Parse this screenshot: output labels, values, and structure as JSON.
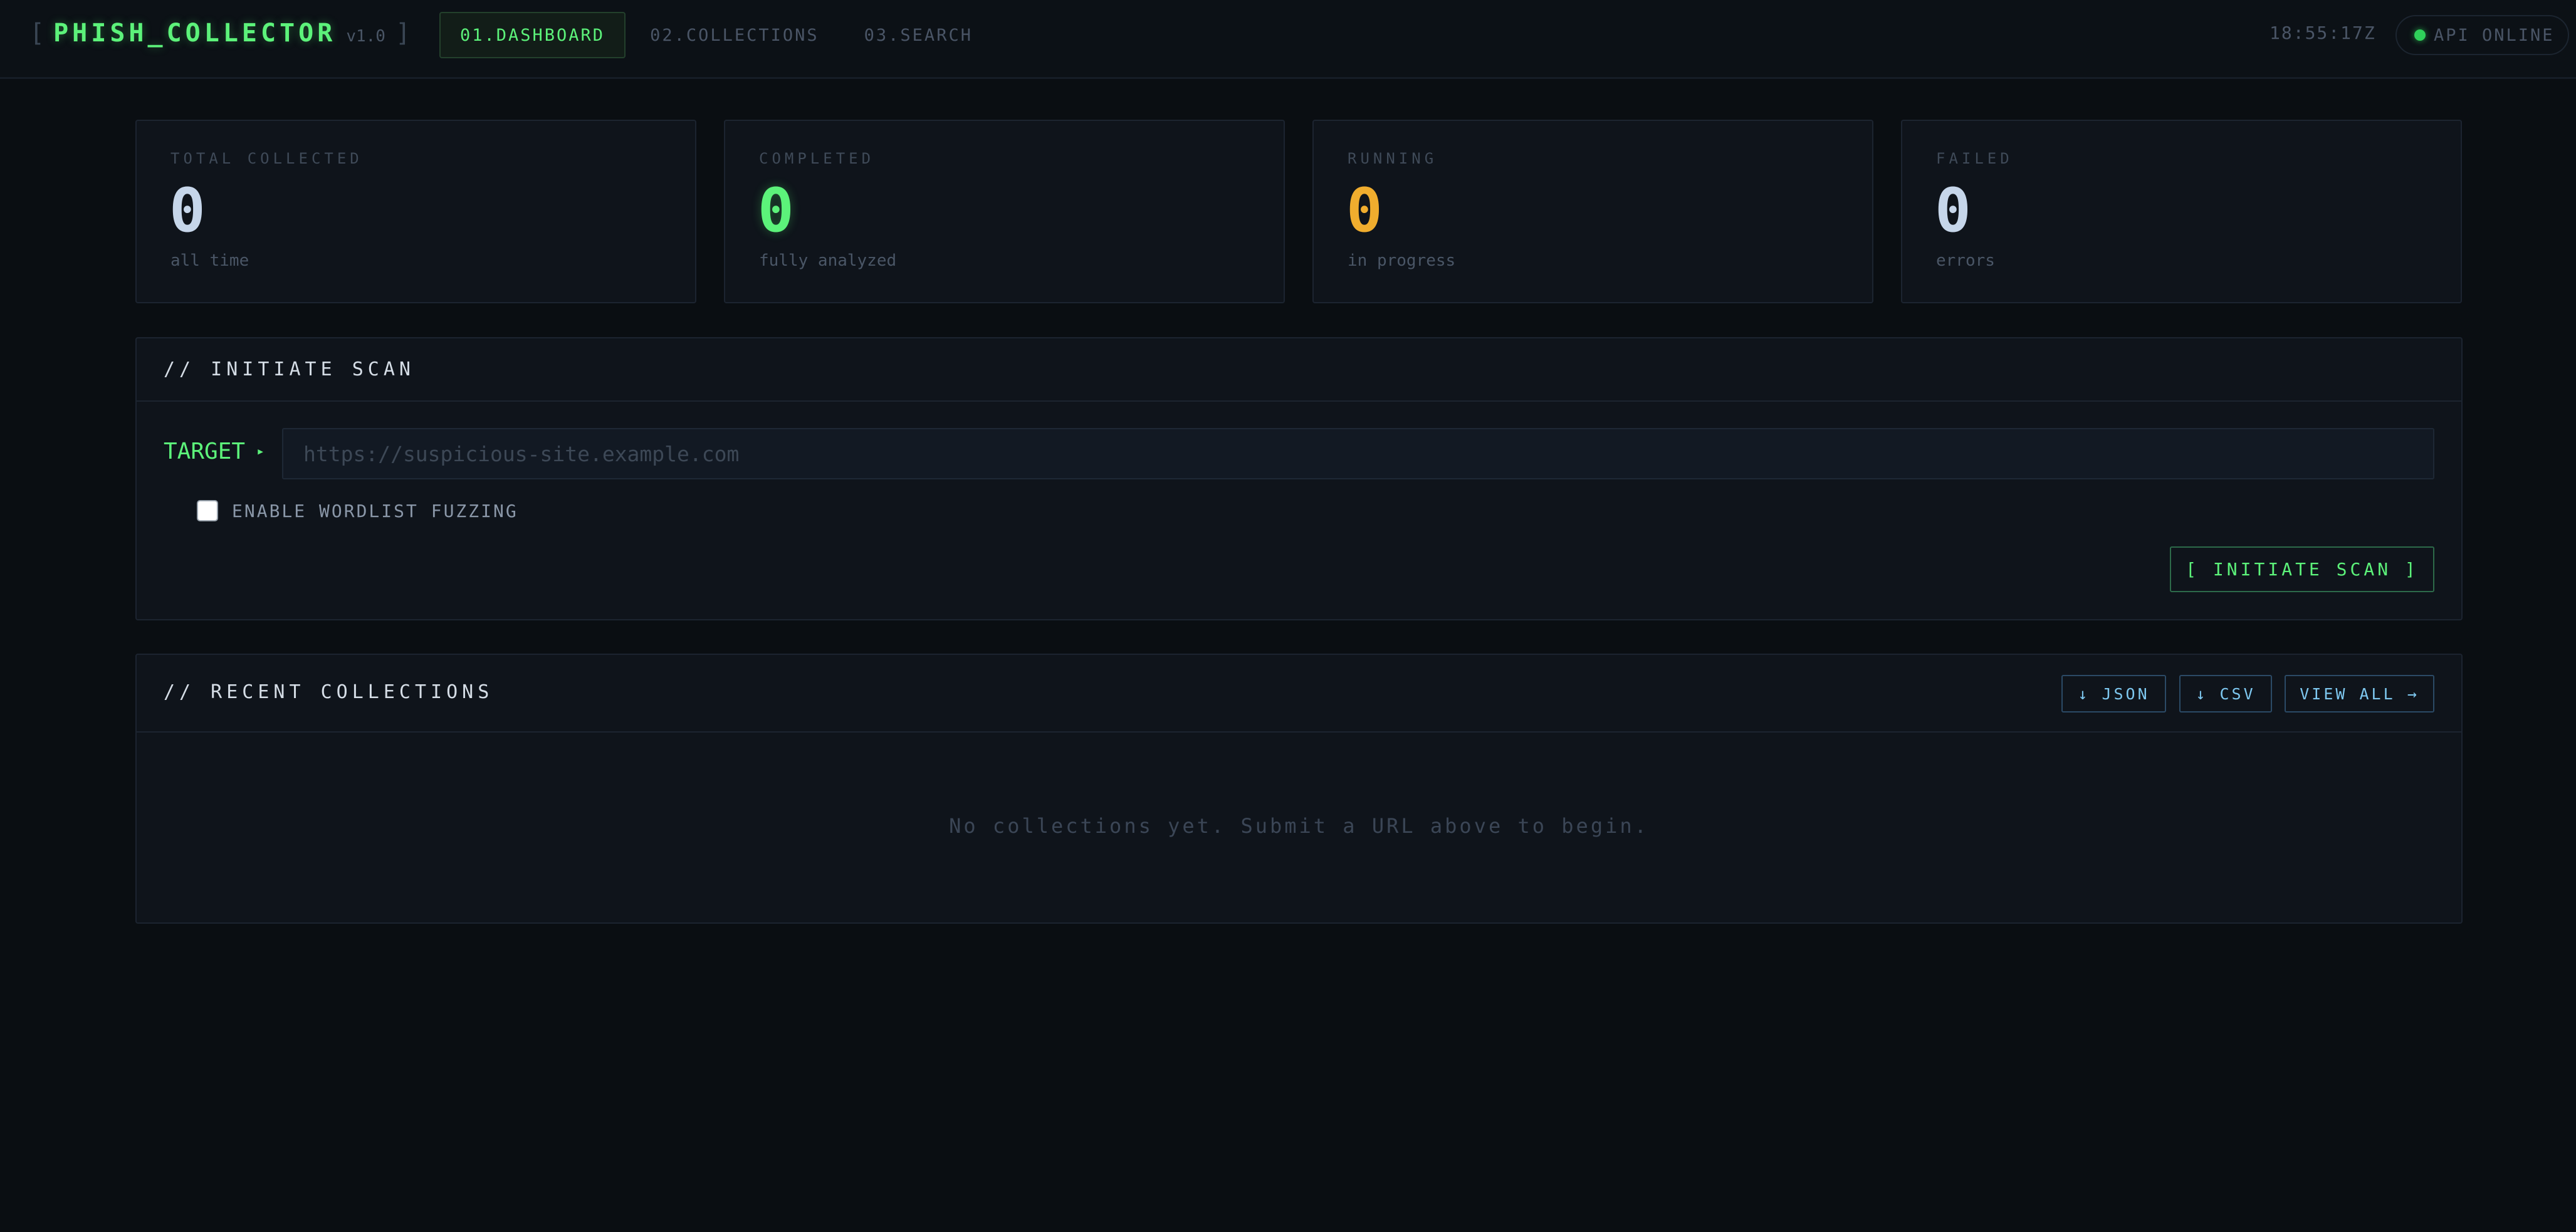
{
  "header": {
    "logo_open_bracket": "[",
    "app_name": "PHISH_COLLECTOR",
    "version": "v1.0",
    "logo_close_bracket": "]",
    "nav_tabs": [
      {
        "label": "01.DASHBOARD",
        "active": true
      },
      {
        "label": "02.COLLECTIONS",
        "active": false
      },
      {
        "label": "03.SEARCH",
        "active": false
      }
    ],
    "clock": "18:55:17Z",
    "api_status": "API ONLINE"
  },
  "stats": [
    {
      "label": "TOTAL COLLECTED",
      "value": "0",
      "sub": "all time"
    },
    {
      "label": "COMPLETED",
      "value": "0",
      "sub": "fully analyzed"
    },
    {
      "label": "RUNNING",
      "value": "0",
      "sub": "in progress"
    },
    {
      "label": "FAILED",
      "value": "0",
      "sub": "errors"
    }
  ],
  "scan": {
    "title": "// INITIATE SCAN",
    "target_label": "TARGET",
    "target_arrow": "▸",
    "target_value": "",
    "target_placeholder": "https://suspicious-site.example.com",
    "fuzzing_label": "ENABLE WORDLIST FUZZING",
    "fuzzing_checked": false,
    "button_label": "[ INITIATE SCAN ]"
  },
  "recent": {
    "title": "// RECENT COLLECTIONS",
    "json_label": "↓ JSON",
    "csv_label": "↓ CSV",
    "view_all_label": "VIEW ALL →",
    "empty_message": "No collections yet. Submit a URL above to begin."
  },
  "colors": {
    "background": "#0a0e12",
    "accent_green": "#5cf27a",
    "running_amber": "#f0ad2e",
    "link_blue": "#7ec8f0",
    "status_online": "#2fd15a"
  },
  "icons": {
    "status": "status-dot-icon",
    "target_arrow": "caret-right-icon",
    "download": "download-arrow-icon",
    "view_all": "arrow-right-icon"
  }
}
